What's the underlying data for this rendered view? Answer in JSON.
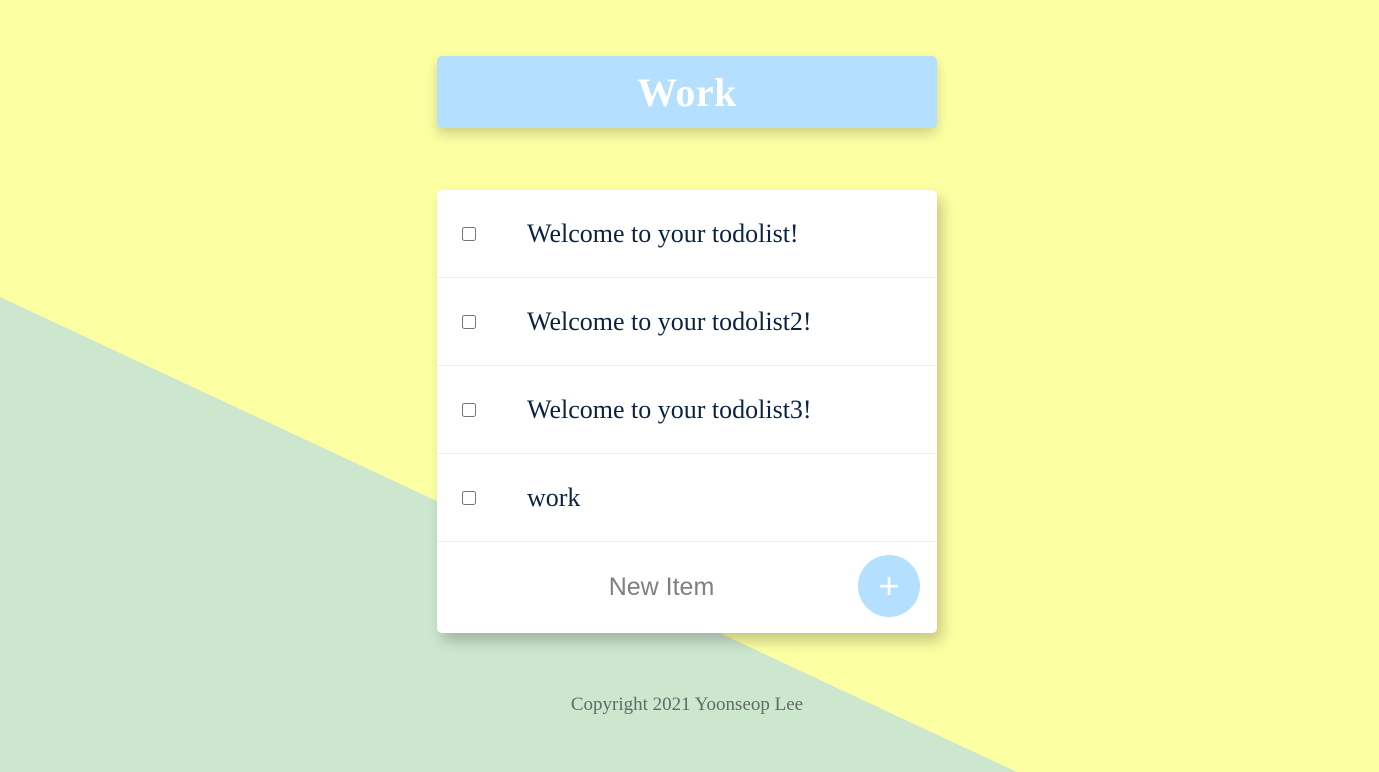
{
  "colors": {
    "background_primary": "#FDFFA3",
    "background_secondary": "#CDE7CF",
    "accent": "#B5DFFF",
    "item_text": "#0A2340",
    "footer_text": "#5E6B66"
  },
  "header": {
    "title": "Work"
  },
  "todo": {
    "items": [
      {
        "text": "Welcome to your todolist!",
        "checked": false
      },
      {
        "text": "Welcome to your todolist2!",
        "checked": false
      },
      {
        "text": "Welcome to your todolist3!",
        "checked": false
      },
      {
        "text": "work",
        "checked": false
      }
    ],
    "new_item": {
      "placeholder": "New Item",
      "value": "",
      "add_button_label": "+",
      "add_button_icon": "plus-icon"
    }
  },
  "footer": {
    "copyright": "Copyright 2021 Yoonseop Lee"
  }
}
